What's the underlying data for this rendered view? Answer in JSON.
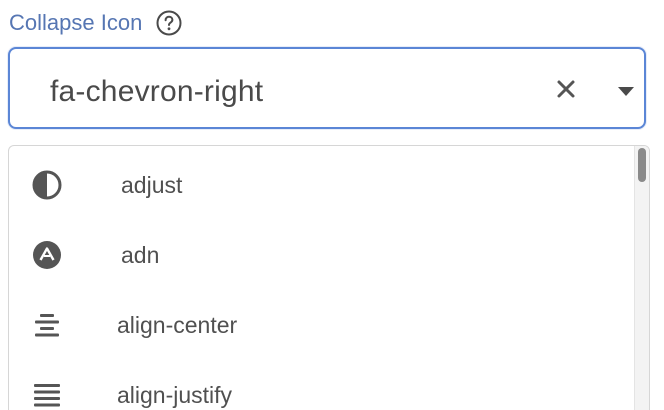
{
  "field": {
    "label": "Collapse Icon",
    "help_icon": "question-circle-icon"
  },
  "select": {
    "value": "fa-chevron-right",
    "clear_icon": "close-x-icon",
    "caret_icon": "caret-down-icon"
  },
  "dropdown": {
    "options": [
      {
        "icon": "adjust-icon",
        "label": "adjust"
      },
      {
        "icon": "adn-icon",
        "label": "adn"
      },
      {
        "icon": "align-center-icon",
        "label": "align-center"
      },
      {
        "icon": "align-justify-icon",
        "label": "align-justify"
      }
    ]
  },
  "colors": {
    "label": "#5676b3",
    "focus_border": "#5b86d6",
    "text": "#4a4a4a",
    "icon": "#555555"
  }
}
